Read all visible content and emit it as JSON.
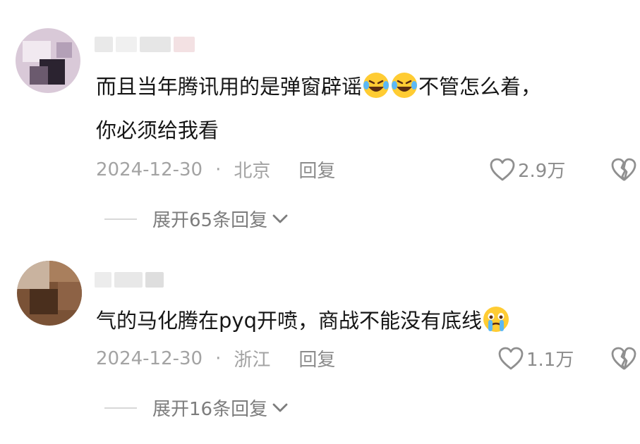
{
  "comments": [
    {
      "text_line1_a": "而且当年腾讯用的是弹窗辟谣",
      "text_line1_emoji": "laughing-crying-emoji",
      "text_line1_b": "不管怎么着，",
      "text_line2": "你必须给我看",
      "date": "2024-12-30",
      "sep": "·",
      "location": "北京",
      "reply_label": "回复",
      "likes": "2.9万",
      "expand_label": "展开65条回复"
    },
    {
      "text_line1_a": "气的马化腾在pyq开喷，商战不能没有底线",
      "text_line1_emoji": "crying-emoji",
      "date": "2024-12-30",
      "sep": "·",
      "location": "浙江",
      "reply_label": "回复",
      "likes": "1.1万",
      "expand_label": "展开16条回复"
    }
  ],
  "colors": {
    "meta": "#a3a3a3",
    "text": "#161616",
    "icon": "#9a9a9a"
  },
  "icons": {
    "like": "heart-outline-icon",
    "dislike": "broken-heart-icon",
    "expand": "chevron-down-icon"
  }
}
